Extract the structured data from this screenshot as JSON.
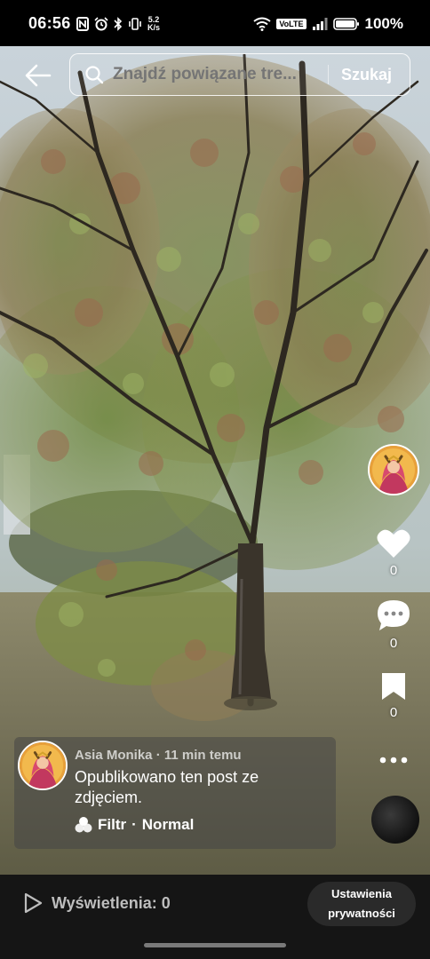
{
  "status_bar": {
    "time": "06:56",
    "net_speed_value": "5.2",
    "net_speed_unit": "K/s",
    "volte": "VoLTE",
    "battery": "100%",
    "icons": [
      "nfc-icon",
      "alarm-icon",
      "bluetooth-icon",
      "vibrate-icon",
      "wifi-icon",
      "signal-icon",
      "battery-icon"
    ]
  },
  "search": {
    "placeholder": "Znajdź powiązane tre...",
    "button_label": "Szukaj"
  },
  "actions": {
    "likes": "0",
    "comments": "0",
    "saves": "0"
  },
  "post": {
    "author": "Asia Monika",
    "time_ago": "11 min temu",
    "caption": "Opublikowano ten post ze zdjęciem.",
    "filter_label": "Filtr",
    "filter_value": "Normal"
  },
  "bottom_bar": {
    "views": "Wyświetlenia: 0",
    "privacy_line1": "Ustawienia",
    "privacy_line2": "prywatności"
  },
  "colors": {
    "accent_white": "#ffffff",
    "panel": "#151515"
  }
}
